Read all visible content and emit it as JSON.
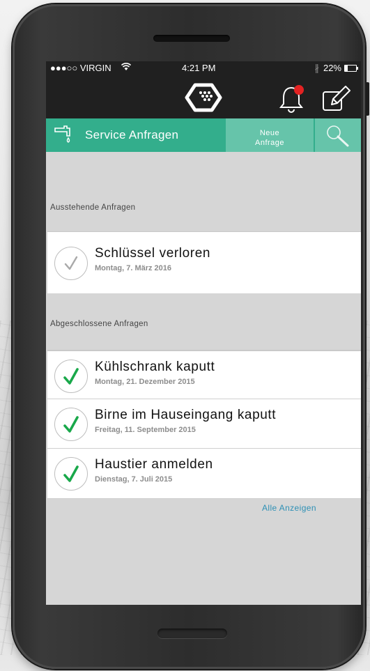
{
  "status_bar": {
    "carrier": "●●●○○ VIRGIN",
    "time": "4:21 PM",
    "battery_percent": "22%",
    "battery_level": 0.22
  },
  "header": {
    "logo_icon": "hexagon-logo-icon",
    "notification_icon": "bell-icon",
    "compose_icon": "compose-icon",
    "notification_badge_color": "#e32222"
  },
  "nav": {
    "title": "Service Anfragen",
    "icon": "faucet-icon",
    "new_request_line1": "Neue",
    "new_request_line2": "Anfrage",
    "search_icon": "search-icon",
    "accent_color": "#33ae8c"
  },
  "pending": {
    "label": "Ausstehende Anfragen",
    "items": [
      {
        "title": "Schlüssel verloren",
        "date": "Montag, 7. März 2016",
        "status": "pending"
      }
    ]
  },
  "completed": {
    "label": "Abgeschlossene Anfragen",
    "items": [
      {
        "title": "Kühlschrank kaputt",
        "date": "Montag, 21. Dezember 2015",
        "status": "done"
      },
      {
        "title": "Birne im Hauseingang kaputt",
        "date": "Freitag, 11. September 2015",
        "status": "done"
      },
      {
        "title": "Haustier anmelden",
        "date": "Dienstag, 7. Juli 2015",
        "status": "done"
      }
    ]
  },
  "show_all_label": "Alle Anzeigen",
  "colors": {
    "check_done": "#19a84a",
    "check_pending": "#a9a9a9",
    "link": "#2d90b5"
  }
}
